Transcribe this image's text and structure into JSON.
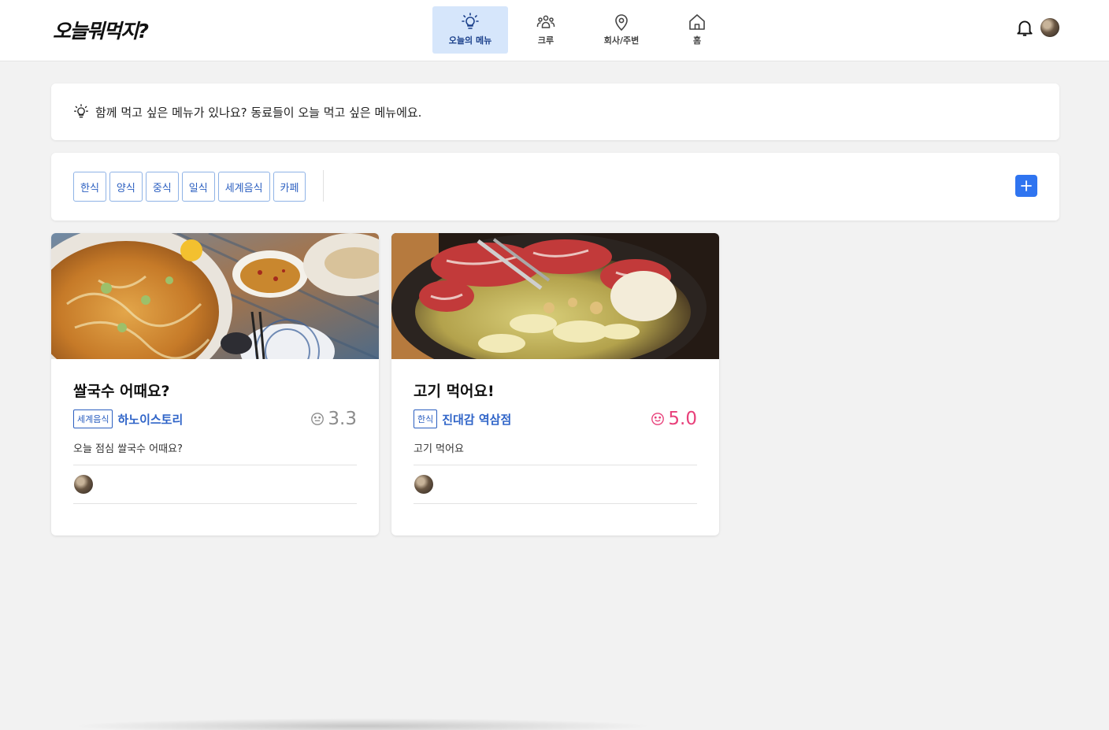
{
  "app": {
    "logo": "오늘뭐먹지?"
  },
  "nav": {
    "items": [
      {
        "label": "오늘의 메뉴",
        "icon": "lightbulb-icon",
        "active": true
      },
      {
        "label": "크루",
        "icon": "people-icon",
        "active": false
      },
      {
        "label": "회사/주변",
        "icon": "map-pin-icon",
        "active": false
      },
      {
        "label": "홈",
        "icon": "home-icon",
        "active": false
      }
    ]
  },
  "header": {
    "bell_icon": "bell-icon",
    "avatar": "user-avatar"
  },
  "notice": {
    "icon": "lightbulb-icon",
    "text": "함께 먹고 싶은 메뉴가 있나요? 동료들이 오늘 먹고 싶은 메뉴에요."
  },
  "filters": {
    "categories": [
      "한식",
      "양식",
      "중식",
      "일식",
      "세계음식",
      "카페"
    ],
    "add_icon": "plus-icon"
  },
  "cards": [
    {
      "title": "쌀국수 어때요?",
      "category": "세계음식",
      "restaurant": "하노이스토리",
      "rating": "3.3",
      "rating_color": "#8c8c8c",
      "description": "오늘 점심 쌀국수 어때요?",
      "image": "pho-noodle-soup-photo"
    },
    {
      "title": "고기 먹어요!",
      "category": "한식",
      "restaurant": "진대감 역삼점",
      "rating": "5.0",
      "rating_color": "#e8407a",
      "description": "고기 먹어요",
      "image": "korean-bbq-photo"
    }
  ],
  "colors": {
    "accent": "#2f74f0",
    "nav_active_bg": "#d6e6fb",
    "link": "#2f64c8"
  }
}
